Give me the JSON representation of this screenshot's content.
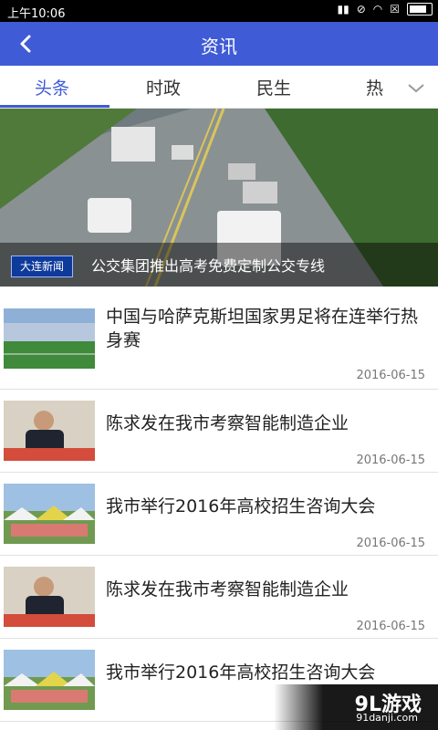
{
  "status_bar": {
    "time": "上午10:06",
    "icons": [
      "signal-icon",
      "mute-icon",
      "wifi-icon",
      "close-box-icon",
      "battery-icon"
    ]
  },
  "app_bar": {
    "title": "资讯"
  },
  "tabs": [
    {
      "label": "头条",
      "active": true
    },
    {
      "label": "时政",
      "active": false
    },
    {
      "label": "民生",
      "active": false
    },
    {
      "label": "热",
      "active": false
    }
  ],
  "hero": {
    "logo_text": "大连新闻",
    "caption": "公交集团推出高考免费定制公交专线"
  },
  "articles": [
    {
      "headline": "中国与哈萨克斯坦国家男足将在连举行热身赛",
      "date": "2016-06-15"
    },
    {
      "headline": "陈求发在我市考察智能制造企业",
      "date": "2016-06-15"
    },
    {
      "headline": "我市举行2016年高校招生咨询大会",
      "date": "2016-06-15"
    },
    {
      "headline": "陈求发在我市考察智能制造企业",
      "date": "2016-06-15"
    },
    {
      "headline": "我市举行2016年高校招生咨询大会",
      "date": ""
    }
  ],
  "watermark": {
    "main": "9L游戏",
    "sub": "91danji.com"
  },
  "colors": {
    "accent": "#3f5bd6",
    "status_bar": "#000000"
  }
}
